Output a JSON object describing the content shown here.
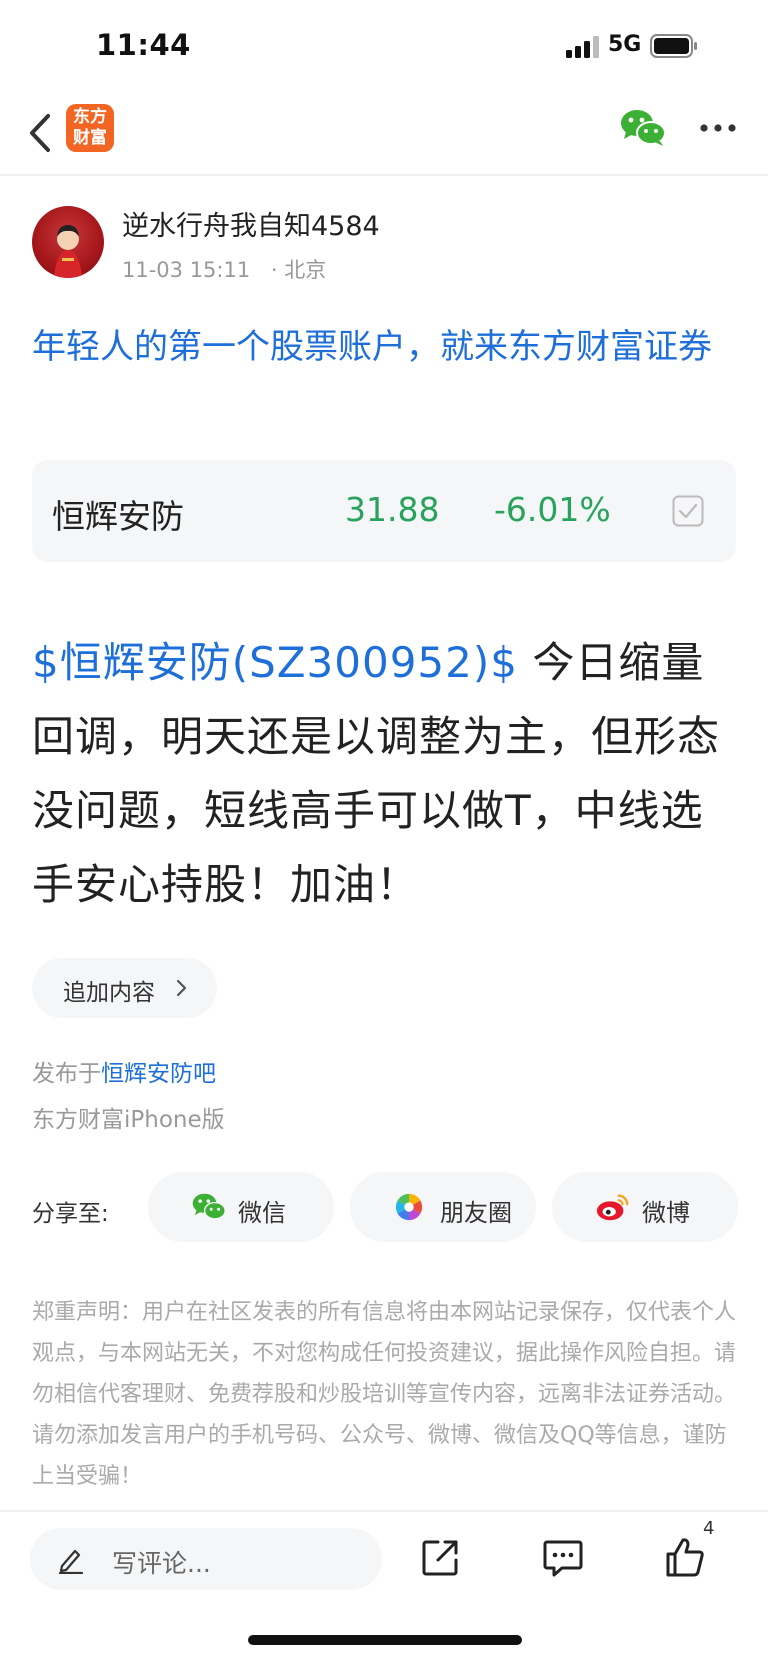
{
  "status_bar": {
    "time": "11:44",
    "network": "5G"
  },
  "nav": {
    "logo_text_line1": "东方",
    "logo_text_line2": "财富"
  },
  "author": {
    "name": "逆水行舟我自知4584",
    "time": "11-03 15:11",
    "location": "· 北京"
  },
  "promo": {
    "text": "年轻人的第一个股票账户，就来东方财富证券"
  },
  "stock_card": {
    "name": "恒辉安防",
    "price": "31.88",
    "change": "-6.01%",
    "price_color": "#27a35b"
  },
  "post": {
    "stock_tag": "$恒辉安防(SZ300952)$",
    "content": " 今日缩量回调，明天还是以调整为主，但形态没问题，短线高手可以做T，中线选手安心持股！加油！"
  },
  "append_button": {
    "label": "追加内容"
  },
  "published_in": {
    "prefix": "发布于",
    "bar_name": "恒辉安防吧"
  },
  "source": "东方财富iPhone版",
  "share": {
    "label": "分享至:",
    "items": [
      {
        "label": "微信",
        "icon": "wechat-icon"
      },
      {
        "label": "朋友圈",
        "icon": "moments-icon"
      },
      {
        "label": "微博",
        "icon": "weibo-icon"
      }
    ]
  },
  "disclaimer": "郑重声明：用户在社区发表的所有信息将由本网站记录保存，仅代表个人观点，与本网站无关，不对您构成任何投资建议，据此操作风险自担。请勿相信代客理财、免费荐股和炒股培训等宣传内容，远离非法证券活动。请勿添加发言用户的手机号码、公众号、微博、微信及QQ等信息，谨防上当受骗！",
  "bottom_bar": {
    "comment_placeholder": "写评论...",
    "like_count": "4"
  },
  "colors": {
    "link": "#1e6fd9",
    "down": "#27a35b",
    "brand": "#f26522",
    "wechat": "#3cb034"
  }
}
